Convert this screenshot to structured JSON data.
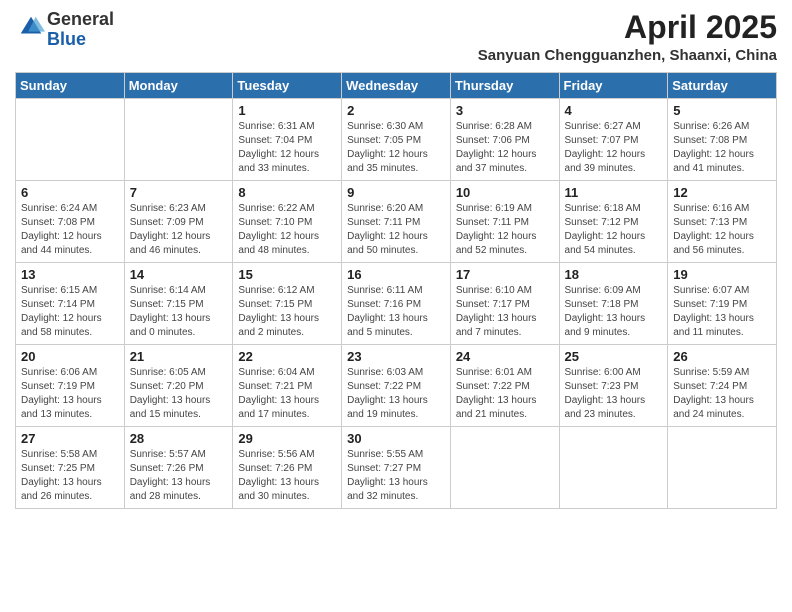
{
  "header": {
    "logo_general": "General",
    "logo_blue": "Blue",
    "title": "April 2025",
    "subtitle": "Sanyuan Chengguanzhen, Shaanxi, China"
  },
  "days_of_week": [
    "Sunday",
    "Monday",
    "Tuesday",
    "Wednesday",
    "Thursday",
    "Friday",
    "Saturday"
  ],
  "weeks": [
    [
      {
        "day": "",
        "info": ""
      },
      {
        "day": "",
        "info": ""
      },
      {
        "day": "1",
        "info": "Sunrise: 6:31 AM\nSunset: 7:04 PM\nDaylight: 12 hours and 33 minutes."
      },
      {
        "day": "2",
        "info": "Sunrise: 6:30 AM\nSunset: 7:05 PM\nDaylight: 12 hours and 35 minutes."
      },
      {
        "day": "3",
        "info": "Sunrise: 6:28 AM\nSunset: 7:06 PM\nDaylight: 12 hours and 37 minutes."
      },
      {
        "day": "4",
        "info": "Sunrise: 6:27 AM\nSunset: 7:07 PM\nDaylight: 12 hours and 39 minutes."
      },
      {
        "day": "5",
        "info": "Sunrise: 6:26 AM\nSunset: 7:08 PM\nDaylight: 12 hours and 41 minutes."
      }
    ],
    [
      {
        "day": "6",
        "info": "Sunrise: 6:24 AM\nSunset: 7:08 PM\nDaylight: 12 hours and 44 minutes."
      },
      {
        "day": "7",
        "info": "Sunrise: 6:23 AM\nSunset: 7:09 PM\nDaylight: 12 hours and 46 minutes."
      },
      {
        "day": "8",
        "info": "Sunrise: 6:22 AM\nSunset: 7:10 PM\nDaylight: 12 hours and 48 minutes."
      },
      {
        "day": "9",
        "info": "Sunrise: 6:20 AM\nSunset: 7:11 PM\nDaylight: 12 hours and 50 minutes."
      },
      {
        "day": "10",
        "info": "Sunrise: 6:19 AM\nSunset: 7:11 PM\nDaylight: 12 hours and 52 minutes."
      },
      {
        "day": "11",
        "info": "Sunrise: 6:18 AM\nSunset: 7:12 PM\nDaylight: 12 hours and 54 minutes."
      },
      {
        "day": "12",
        "info": "Sunrise: 6:16 AM\nSunset: 7:13 PM\nDaylight: 12 hours and 56 minutes."
      }
    ],
    [
      {
        "day": "13",
        "info": "Sunrise: 6:15 AM\nSunset: 7:14 PM\nDaylight: 12 hours and 58 minutes."
      },
      {
        "day": "14",
        "info": "Sunrise: 6:14 AM\nSunset: 7:15 PM\nDaylight: 13 hours and 0 minutes."
      },
      {
        "day": "15",
        "info": "Sunrise: 6:12 AM\nSunset: 7:15 PM\nDaylight: 13 hours and 2 minutes."
      },
      {
        "day": "16",
        "info": "Sunrise: 6:11 AM\nSunset: 7:16 PM\nDaylight: 13 hours and 5 minutes."
      },
      {
        "day": "17",
        "info": "Sunrise: 6:10 AM\nSunset: 7:17 PM\nDaylight: 13 hours and 7 minutes."
      },
      {
        "day": "18",
        "info": "Sunrise: 6:09 AM\nSunset: 7:18 PM\nDaylight: 13 hours and 9 minutes."
      },
      {
        "day": "19",
        "info": "Sunrise: 6:07 AM\nSunset: 7:19 PM\nDaylight: 13 hours and 11 minutes."
      }
    ],
    [
      {
        "day": "20",
        "info": "Sunrise: 6:06 AM\nSunset: 7:19 PM\nDaylight: 13 hours and 13 minutes."
      },
      {
        "day": "21",
        "info": "Sunrise: 6:05 AM\nSunset: 7:20 PM\nDaylight: 13 hours and 15 minutes."
      },
      {
        "day": "22",
        "info": "Sunrise: 6:04 AM\nSunset: 7:21 PM\nDaylight: 13 hours and 17 minutes."
      },
      {
        "day": "23",
        "info": "Sunrise: 6:03 AM\nSunset: 7:22 PM\nDaylight: 13 hours and 19 minutes."
      },
      {
        "day": "24",
        "info": "Sunrise: 6:01 AM\nSunset: 7:22 PM\nDaylight: 13 hours and 21 minutes."
      },
      {
        "day": "25",
        "info": "Sunrise: 6:00 AM\nSunset: 7:23 PM\nDaylight: 13 hours and 23 minutes."
      },
      {
        "day": "26",
        "info": "Sunrise: 5:59 AM\nSunset: 7:24 PM\nDaylight: 13 hours and 24 minutes."
      }
    ],
    [
      {
        "day": "27",
        "info": "Sunrise: 5:58 AM\nSunset: 7:25 PM\nDaylight: 13 hours and 26 minutes."
      },
      {
        "day": "28",
        "info": "Sunrise: 5:57 AM\nSunset: 7:26 PM\nDaylight: 13 hours and 28 minutes."
      },
      {
        "day": "29",
        "info": "Sunrise: 5:56 AM\nSunset: 7:26 PM\nDaylight: 13 hours and 30 minutes."
      },
      {
        "day": "30",
        "info": "Sunrise: 5:55 AM\nSunset: 7:27 PM\nDaylight: 13 hours and 32 minutes."
      },
      {
        "day": "",
        "info": ""
      },
      {
        "day": "",
        "info": ""
      },
      {
        "day": "",
        "info": ""
      }
    ]
  ]
}
